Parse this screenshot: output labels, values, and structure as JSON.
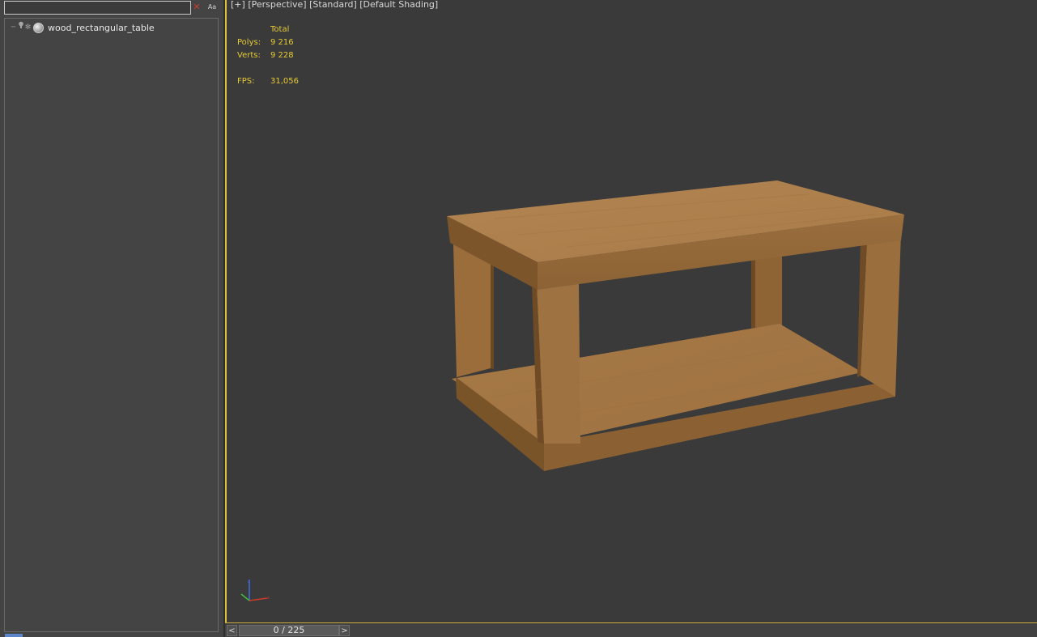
{
  "scene_explorer": {
    "search": {
      "value": "",
      "placeholder": ""
    },
    "clear_icon": "✕",
    "case_label": "Aa",
    "objects": [
      {
        "label": "wood_rectangular_table",
        "icon": "sphere-icon"
      }
    ]
  },
  "viewport": {
    "labels": {
      "plus": "[+]",
      "view": "[Perspective]",
      "mode": "[Standard]",
      "shading": "[Default Shading]"
    },
    "stats": {
      "header": "Total",
      "polys_label": "Polys:",
      "polys_value": "9 216",
      "verts_label": "Verts:",
      "verts_value": "9 228",
      "fps_label": "FPS:",
      "fps_value": "31,056"
    },
    "scene_object": "wood_rectangular_table",
    "colors": {
      "background": "#3a3a3a",
      "active_border": "#e1c13c",
      "stats_text": "#e7cb34",
      "wood": "#a87c49"
    }
  },
  "timeline": {
    "prev": "<",
    "next": ">",
    "frame_display": "0 / 225",
    "current_frame": 0,
    "total_frames": 225
  }
}
